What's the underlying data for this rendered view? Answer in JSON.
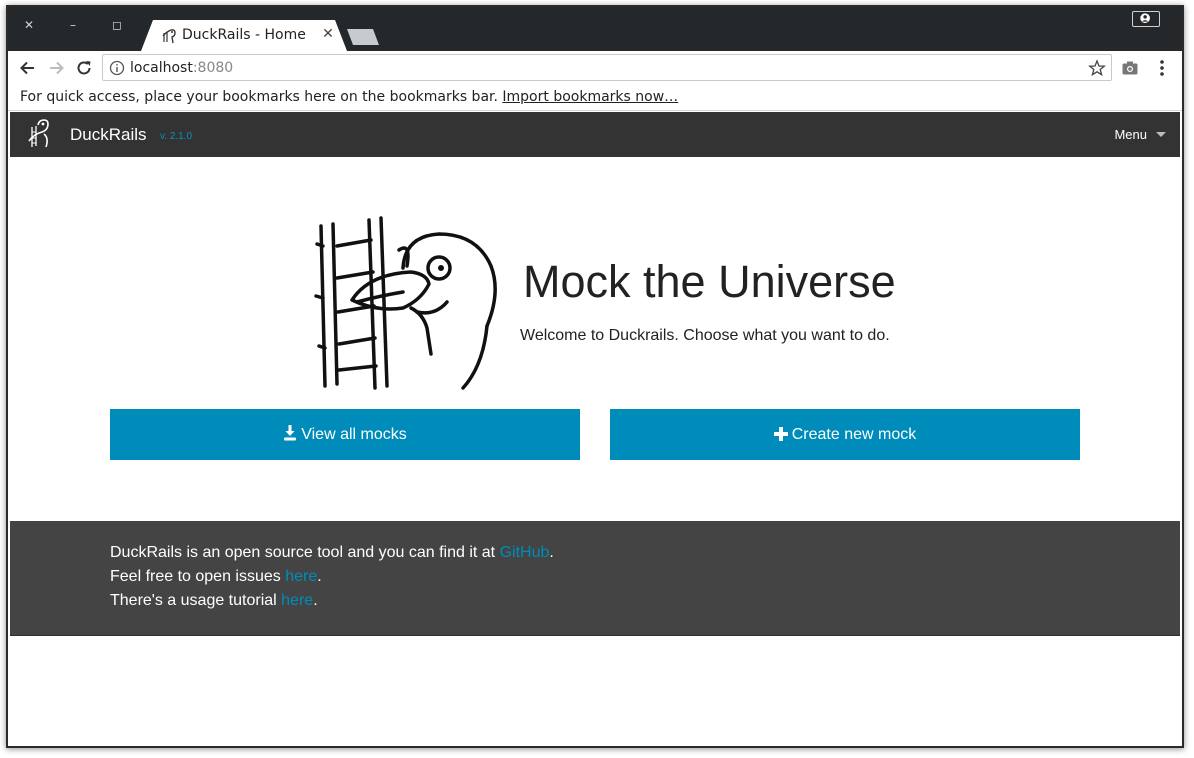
{
  "browser": {
    "tab": {
      "title": "DuckRails - Home"
    },
    "address": {
      "host": "localhost",
      "port": ":8080"
    },
    "bookmarks_bar": {
      "text": "For quick access, place your bookmarks here on the bookmarks bar. ",
      "link": "Import bookmarks now…"
    }
  },
  "navbar": {
    "brand": "DuckRails",
    "version": "v. 2.1.0",
    "menu_label": "Menu"
  },
  "hero": {
    "title": "Mock the Universe",
    "subtitle": "Welcome to Duckrails. Choose what you want to do."
  },
  "actions": {
    "view_all": {
      "label": "View all mocks",
      "icon": "download-icon"
    },
    "create_new": {
      "label": "Create new mock",
      "icon": "plus-icon"
    }
  },
  "footer": {
    "line1_prefix": "DuckRails is an open source tool and you can find it at ",
    "line1_link": "GitHub",
    "line2_prefix": "Feel free to open issues ",
    "line2_link": "here",
    "line3_prefix": "There's a usage tutorial ",
    "line3_link": "here",
    "suffix": "."
  },
  "colors": {
    "navbar": "#333333",
    "primary": "#008cba",
    "footer": "#444444",
    "chrome_frame": "#24282b"
  }
}
